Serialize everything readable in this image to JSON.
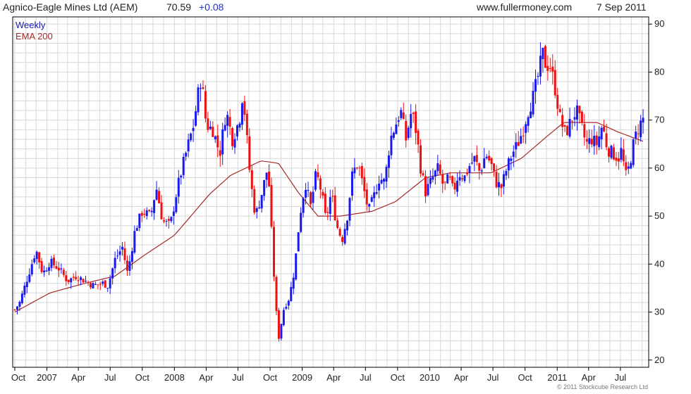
{
  "header": {
    "title": "Agnico-Eagle Mines Ltd (AEM)",
    "price": "70.59",
    "change": "+0.08",
    "site": "www.fullermoney.com",
    "date": "7 Sep 2011"
  },
  "footer": {
    "copyright": "© 2011 Stockcube Research Ltd"
  },
  "colors": {
    "up": "#1a1aee",
    "down": "#ee1111",
    "ema": "#a52a2a",
    "grid": "#d8d8d8",
    "legend_weekly": "#1a1ab0"
  },
  "chart_data": {
    "type": "candlestick",
    "frequency": "Weekly",
    "legend": [
      {
        "name": "Weekly",
        "color": "#1a1ab0"
      },
      {
        "name": "EMA 200",
        "color": "#a52a2a"
      }
    ],
    "legend_position": "top-left",
    "grid": true,
    "x_ticks": [
      "Oct",
      "2007",
      "Apr",
      "Jul",
      "Oct",
      "2008",
      "Apr",
      "Jul",
      "Oct",
      "2009",
      "Apr",
      "Jul",
      "Oct",
      "2010",
      "Apr",
      "Jul",
      "Oct",
      "2011",
      "Apr",
      "Jul"
    ],
    "x_range": [
      "Oct 2006",
      "Sep 2011"
    ],
    "y_ticks": [
      20,
      30,
      40,
      50,
      60,
      70,
      80,
      90
    ],
    "ylim": [
      18.5,
      91.5
    ],
    "y_axis_position": "right",
    "anchors_price": [
      [
        "2006-10-01",
        30.5
      ],
      [
        "2006-10-15",
        32
      ],
      [
        "2006-11-10",
        38
      ],
      [
        "2006-12-01",
        43
      ],
      [
        "2006-12-20",
        38
      ],
      [
        "2007-01-10",
        40.5
      ],
      [
        "2007-02-05",
        39
      ],
      [
        "2007-03-01",
        36.5
      ],
      [
        "2007-03-25",
        37.5
      ],
      [
        "2007-04-20",
        36.5
      ],
      [
        "2007-05-15",
        35.5
      ],
      [
        "2007-06-10",
        36
      ],
      [
        "2007-06-25",
        35.5
      ],
      [
        "2007-07-15",
        41
      ],
      [
        "2007-08-05",
        43.5
      ],
      [
        "2007-08-20",
        38
      ],
      [
        "2007-09-10",
        47
      ],
      [
        "2007-10-01",
        51
      ],
      [
        "2007-10-25",
        50
      ],
      [
        "2007-11-10",
        56
      ],
      [
        "2007-11-28",
        49
      ],
      [
        "2007-12-20",
        48
      ],
      [
        "2008-01-10",
        56
      ],
      [
        "2008-01-25",
        60.5
      ],
      [
        "2008-02-10",
        65
      ],
      [
        "2008-02-25",
        69
      ],
      [
        "2008-03-10",
        76
      ],
      [
        "2008-03-18",
        79
      ],
      [
        "2008-04-01",
        69
      ],
      [
        "2008-04-20",
        68
      ],
      [
        "2008-05-10",
        63
      ],
      [
        "2008-05-28",
        72
      ],
      [
        "2008-06-15",
        66
      ],
      [
        "2008-07-05",
        70
      ],
      [
        "2008-07-15",
        76
      ],
      [
        "2008-08-05",
        58
      ],
      [
        "2008-08-20",
        50
      ],
      [
        "2008-09-05",
        54
      ],
      [
        "2008-09-25",
        60.5
      ],
      [
        "2008-10-10",
        40
      ],
      [
        "2008-10-24",
        24
      ],
      [
        "2008-11-10",
        31
      ],
      [
        "2008-11-25",
        33
      ],
      [
        "2008-12-10",
        39
      ],
      [
        "2008-12-25",
        50
      ],
      [
        "2009-01-10",
        57
      ],
      [
        "2009-01-25",
        52
      ],
      [
        "2009-02-10",
        59
      ],
      [
        "2009-02-25",
        55
      ],
      [
        "2009-03-10",
        49
      ],
      [
        "2009-03-25",
        55
      ],
      [
        "2009-04-10",
        48
      ],
      [
        "2009-04-25",
        45
      ],
      [
        "2009-05-10",
        50
      ],
      [
        "2009-05-25",
        59
      ],
      [
        "2009-06-10",
        61
      ],
      [
        "2009-06-25",
        56
      ],
      [
        "2009-07-10",
        51
      ],
      [
        "2009-07-25",
        54
      ],
      [
        "2009-08-10",
        58
      ],
      [
        "2009-08-25",
        57
      ],
      [
        "2009-09-10",
        66
      ],
      [
        "2009-09-25",
        69
      ],
      [
        "2009-10-10",
        72
      ],
      [
        "2009-10-25",
        66
      ],
      [
        "2009-11-10",
        72
      ],
      [
        "2009-11-25",
        67
      ],
      [
        "2009-12-05",
        60.5
      ],
      [
        "2009-12-20",
        55
      ],
      [
        "2010-01-10",
        58
      ],
      [
        "2010-01-25",
        60
      ],
      [
        "2010-02-10",
        56
      ],
      [
        "2010-02-25",
        58
      ],
      [
        "2010-03-10",
        55
      ],
      [
        "2010-03-25",
        59
      ],
      [
        "2010-04-10",
        58
      ],
      [
        "2010-04-25",
        60.5
      ],
      [
        "2010-05-10",
        62
      ],
      [
        "2010-05-25",
        59
      ],
      [
        "2010-06-10",
        63
      ],
      [
        "2010-06-25",
        61
      ],
      [
        "2010-07-10",
        57
      ],
      [
        "2010-07-25",
        56
      ],
      [
        "2010-08-10",
        60
      ],
      [
        "2010-08-25",
        63
      ],
      [
        "2010-09-10",
        65
      ],
      [
        "2010-09-25",
        68
      ],
      [
        "2010-10-10",
        72
      ],
      [
        "2010-10-25",
        75
      ],
      [
        "2010-11-10",
        80
      ],
      [
        "2010-11-20",
        84
      ],
      [
        "2010-12-01",
        81
      ],
      [
        "2010-12-10",
        82
      ],
      [
        "2010-12-25",
        77
      ],
      [
        "2011-01-10",
        70
      ],
      [
        "2011-01-25",
        67
      ],
      [
        "2011-02-10",
        70
      ],
      [
        "2011-02-25",
        72
      ],
      [
        "2011-03-10",
        69
      ],
      [
        "2011-03-25",
        65
      ],
      [
        "2011-04-10",
        66
      ],
      [
        "2011-04-25",
        65
      ],
      [
        "2011-05-10",
        69
      ],
      [
        "2011-05-25",
        64
      ],
      [
        "2011-06-10",
        63
      ],
      [
        "2011-06-25",
        62
      ],
      [
        "2011-07-05",
        64
      ],
      [
        "2011-07-15",
        58
      ],
      [
        "2011-07-25",
        60
      ],
      [
        "2011-08-10",
        66
      ],
      [
        "2011-08-25",
        69
      ],
      [
        "2011-09-07",
        70.6
      ]
    ],
    "anchors_ema200": [
      [
        "2006-10-01",
        30
      ],
      [
        "2007-01-10",
        34
      ],
      [
        "2007-04-20",
        36
      ],
      [
        "2007-07-15",
        37.5
      ],
      [
        "2007-10-10",
        42
      ],
      [
        "2008-01-01",
        46
      ],
      [
        "2008-04-10",
        54.5
      ],
      [
        "2008-06-10",
        58.5
      ],
      [
        "2008-09-05",
        61.5
      ],
      [
        "2008-10-25",
        61
      ],
      [
        "2008-12-20",
        55
      ],
      [
        "2009-02-15",
        50
      ],
      [
        "2009-04-20",
        50
      ],
      [
        "2009-07-20",
        51
      ],
      [
        "2009-09-25",
        53
      ],
      [
        "2009-12-20",
        58
      ],
      [
        "2010-03-01",
        59
      ],
      [
        "2010-06-25",
        59
      ],
      [
        "2010-09-20",
        62
      ],
      [
        "2010-12-01",
        66.5
      ],
      [
        "2011-01-20",
        69.5
      ],
      [
        "2011-04-25",
        69.5
      ],
      [
        "2011-06-25",
        67.5
      ],
      [
        "2011-09-07",
        65.5
      ]
    ]
  }
}
